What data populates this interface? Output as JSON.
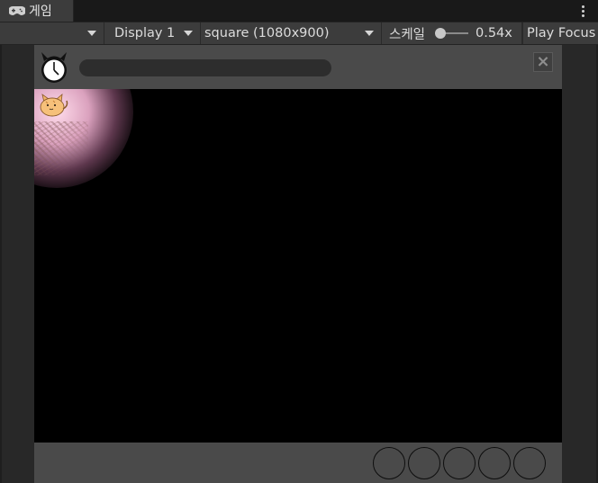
{
  "tab": {
    "label": "게임",
    "icon": "gamepad-icon"
  },
  "toolbar": {
    "display_label": "Display 1",
    "resolution_label": "square (1080x900)",
    "scale_label": "스케일",
    "scale_value": "0.54x",
    "scale_fraction": 0.2,
    "play_focus_label": "Play Focus"
  },
  "game": {
    "progress_fraction": 0.0,
    "close_label": "×",
    "inventory_slots": 5
  },
  "colors": {
    "editor_bg": "#282828",
    "toolbar_bg": "#3c3c3c",
    "game_panel": "#4a4a4a",
    "game_stage": "#000000",
    "glow": "#f0c8dc"
  }
}
